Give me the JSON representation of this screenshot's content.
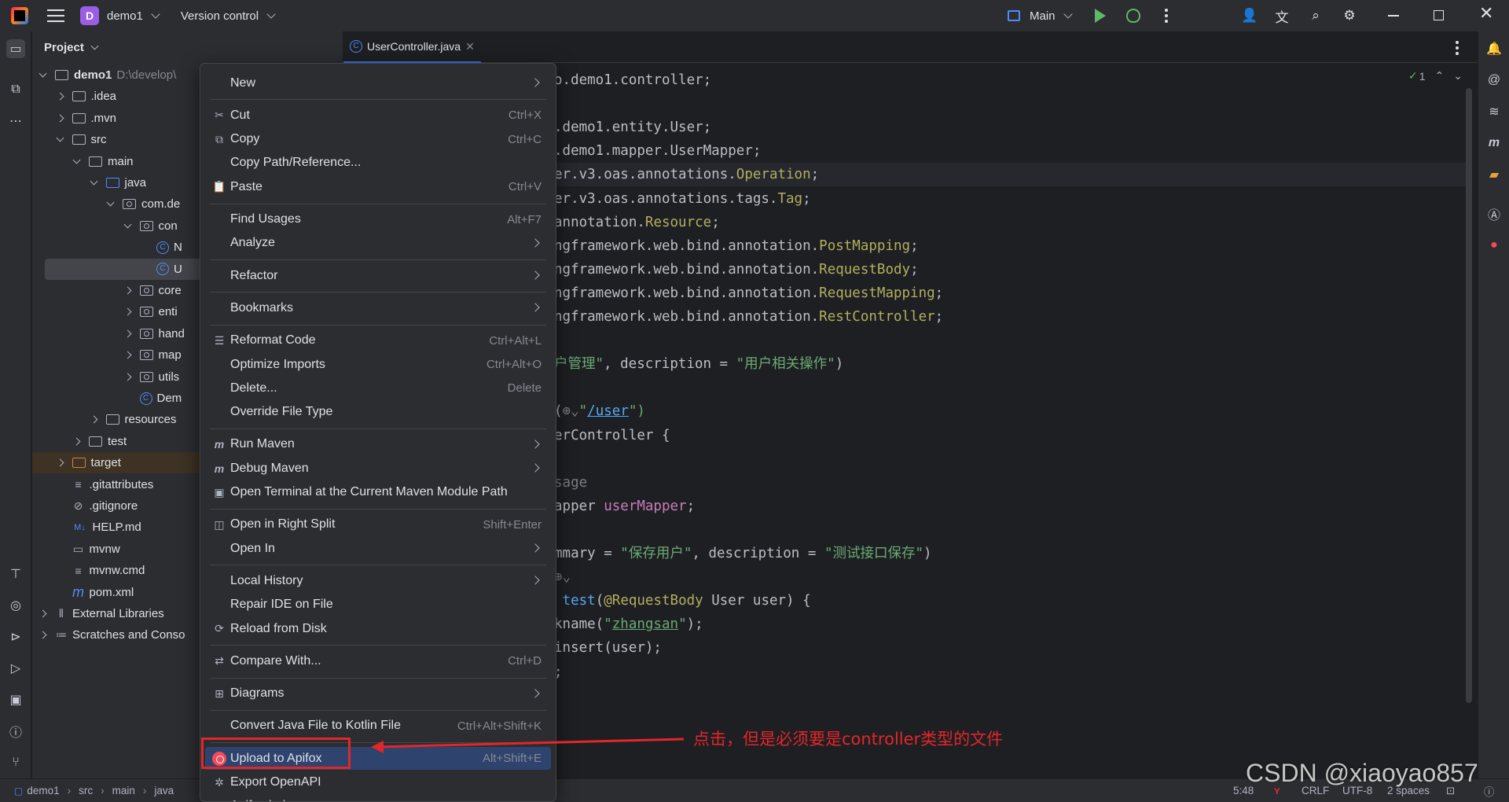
{
  "titlebar": {
    "project_letter": "D",
    "project_name": "demo1",
    "vcs": "Version control",
    "run_config": "Main"
  },
  "project_panel": {
    "title": "Project",
    "tree": [
      {
        "label": "demo1",
        "sub": "D:\\develop\\",
        "bold": true,
        "indent": 0,
        "arrow": "down",
        "icon": "module-folder"
      },
      {
        "label": ".idea",
        "indent": 1,
        "arrow": "right",
        "icon": "folder"
      },
      {
        "label": ".mvn",
        "indent": 1,
        "arrow": "right",
        "icon": "folder"
      },
      {
        "label": "src",
        "indent": 1,
        "arrow": "down",
        "icon": "folder"
      },
      {
        "label": "main",
        "indent": 2,
        "arrow": "down",
        "icon": "folder"
      },
      {
        "label": "java",
        "indent": 3,
        "arrow": "down",
        "icon": "source-folder"
      },
      {
        "label": "com.de",
        "indent": 4,
        "arrow": "down",
        "icon": "package"
      },
      {
        "label": "con",
        "indent": 5,
        "arrow": "down",
        "icon": "package"
      },
      {
        "label": "N",
        "indent": 6,
        "arrow": "none",
        "icon": "class"
      },
      {
        "label": "U",
        "indent": 6,
        "arrow": "none",
        "icon": "class",
        "selected": true
      },
      {
        "label": "core",
        "indent": 5,
        "arrow": "right",
        "icon": "package"
      },
      {
        "label": "enti",
        "indent": 5,
        "arrow": "right",
        "icon": "package"
      },
      {
        "label": "hand",
        "indent": 5,
        "arrow": "right",
        "icon": "package"
      },
      {
        "label": "map",
        "indent": 5,
        "arrow": "right",
        "icon": "package"
      },
      {
        "label": "utils",
        "indent": 5,
        "arrow": "right",
        "icon": "package"
      },
      {
        "label": "Dem",
        "indent": 5,
        "arrow": "none",
        "icon": "class"
      },
      {
        "label": "resources",
        "indent": 3,
        "arrow": "right",
        "icon": "resources-folder"
      },
      {
        "label": "test",
        "indent": 2,
        "arrow": "right",
        "icon": "folder"
      },
      {
        "label": "target",
        "indent": 1,
        "arrow": "right",
        "icon": "excluded-folder",
        "target": true
      },
      {
        "label": ".gitattributes",
        "indent": 1,
        "arrow": "none",
        "icon": "text-file"
      },
      {
        "label": ".gitignore",
        "indent": 1,
        "arrow": "none",
        "icon": "ignore-file"
      },
      {
        "label": "HELP.md",
        "indent": 1,
        "arrow": "none",
        "icon": "markdown-file"
      },
      {
        "label": "mvnw",
        "indent": 1,
        "arrow": "none",
        "icon": "shell-file"
      },
      {
        "label": "mvnw.cmd",
        "indent": 1,
        "arrow": "none",
        "icon": "text-file"
      },
      {
        "label": "pom.xml",
        "indent": 1,
        "arrow": "none",
        "icon": "maven-file"
      },
      {
        "label": "External Libraries",
        "indent": 0,
        "arrow": "right",
        "icon": "library"
      },
      {
        "label": "Scratches and Conso",
        "indent": 0,
        "arrow": "right",
        "icon": "scratches"
      }
    ]
  },
  "editor": {
    "tab_label": "UserController.java",
    "inspection_count": "1",
    "code": [
      [
        {
          "t": "o.demo1.controller;",
          "c": ""
        }
      ],
      [
        {
          "t": "",
          "c": ""
        }
      ],
      [
        {
          "t": ".demo1.entity.User;",
          "c": ""
        }
      ],
      [
        {
          "t": ".demo1.mapper.UserMapper;",
          "c": ""
        }
      ],
      [
        {
          "t": "er.v3.oas.annotations.",
          "c": ""
        },
        {
          "t": "Operation",
          "c": "a"
        },
        {
          "t": ";",
          "c": ""
        }
      ],
      [
        {
          "t": "er.v3.oas.annotations.tags.",
          "c": ""
        },
        {
          "t": "Tag",
          "c": "a"
        },
        {
          "t": ";",
          "c": ""
        }
      ],
      [
        {
          "t": "annotation.",
          "c": ""
        },
        {
          "t": "Resource",
          "c": "a"
        },
        {
          "t": ";",
          "c": ""
        }
      ],
      [
        {
          "t": "ngframework.web.bind.annotation.",
          "c": ""
        },
        {
          "t": "PostMapping",
          "c": "a"
        },
        {
          "t": ";",
          "c": ""
        }
      ],
      [
        {
          "t": "ngframework.web.bind.annotation.",
          "c": ""
        },
        {
          "t": "RequestBody",
          "c": "a"
        },
        {
          "t": ";",
          "c": ""
        }
      ],
      [
        {
          "t": "ngframework.web.bind.annotation.",
          "c": ""
        },
        {
          "t": "RequestMapping",
          "c": "a"
        },
        {
          "t": ";",
          "c": ""
        }
      ],
      [
        {
          "t": "ngframework.web.bind.annotation.",
          "c": ""
        },
        {
          "t": "RestController",
          "c": "a"
        },
        {
          "t": ";",
          "c": ""
        }
      ],
      [
        {
          "t": "",
          "c": ""
        }
      ],
      [
        {
          "t": "户管理\"",
          "c": "s"
        },
        {
          "t": ", description = ",
          "c": ""
        },
        {
          "t": "\"用户相关操作\"",
          "c": "s"
        },
        {
          "t": ")",
          "c": ""
        }
      ],
      [
        {
          "t": "",
          "c": ""
        }
      ],
      [
        {
          "t": "(",
          "c": ""
        },
        {
          "t": "⊕⌄",
          "c": "cm"
        },
        {
          "t": "\"",
          "c": "s"
        },
        {
          "t": "/user",
          "c": "u2"
        },
        {
          "t": "\")",
          "c": "s"
        }
      ],
      [
        {
          "t": "erController {",
          "c": ""
        }
      ],
      [
        {
          "t": "",
          "c": ""
        }
      ],
      [
        {
          "t": "sage",
          "c": "cm"
        }
      ],
      [
        {
          "t": "apper ",
          "c": ""
        },
        {
          "t": "userMapper",
          "c": "f"
        },
        {
          "t": ";",
          "c": ""
        }
      ],
      [
        {
          "t": "",
          "c": ""
        }
      ],
      [
        {
          "t": "mmary = ",
          "c": ""
        },
        {
          "t": "\"保存用户\"",
          "c": "s"
        },
        {
          "t": ", description = ",
          "c": ""
        },
        {
          "t": "\"测试接口保存\"",
          "c": "s"
        },
        {
          "t": ")",
          "c": ""
        }
      ],
      [
        {
          "t": "⊕⌄",
          "c": "cm"
        }
      ],
      [
        {
          "t": " ",
          "c": ""
        },
        {
          "t": "test",
          "c": "fn"
        },
        {
          "t": "(",
          "c": ""
        },
        {
          "t": "@RequestBody",
          "c": "a"
        },
        {
          "t": " User user) {",
          "c": ""
        }
      ],
      [
        {
          "t": "kname(",
          "c": ""
        },
        {
          "t": "\"",
          "c": "s"
        },
        {
          "t": "zhangsan",
          "c": "u"
        },
        {
          "t": "\"",
          "c": "s"
        },
        {
          "t": ");",
          "c": ""
        }
      ],
      [
        {
          "t": "insert(user);",
          "c": ""
        }
      ],
      [
        {
          "t": ";",
          "c": ""
        }
      ]
    ]
  },
  "context_menu": {
    "items": [
      {
        "type": "item",
        "label": "New",
        "submenu": true
      },
      {
        "type": "sep"
      },
      {
        "type": "item",
        "label": "Cut",
        "shortcut": "Ctrl+X",
        "icon": "scissors-icon",
        "glyph": "✂"
      },
      {
        "type": "item",
        "label": "Copy",
        "shortcut": "Ctrl+C",
        "icon": "copy-icon",
        "glyph": "⧉"
      },
      {
        "type": "item",
        "label": "Copy Path/Reference..."
      },
      {
        "type": "item",
        "label": "Paste",
        "shortcut": "Ctrl+V",
        "icon": "paste-icon",
        "glyph": "📋"
      },
      {
        "type": "sep"
      },
      {
        "type": "item",
        "label": "Find Usages",
        "shortcut": "Alt+F7"
      },
      {
        "type": "item",
        "label": "Analyze",
        "submenu": true
      },
      {
        "type": "sep"
      },
      {
        "type": "item",
        "label": "Refactor",
        "submenu": true
      },
      {
        "type": "sep"
      },
      {
        "type": "item",
        "label": "Bookmarks",
        "submenu": true
      },
      {
        "type": "sep"
      },
      {
        "type": "item",
        "label": "Reformat Code",
        "shortcut": "Ctrl+Alt+L",
        "icon": "reformat-icon",
        "glyph": "☰"
      },
      {
        "type": "item",
        "label": "Optimize Imports",
        "shortcut": "Ctrl+Alt+O"
      },
      {
        "type": "item",
        "label": "Delete...",
        "shortcut": "Delete"
      },
      {
        "type": "item",
        "label": "Override File Type"
      },
      {
        "type": "sep"
      },
      {
        "type": "item",
        "label": "Run Maven",
        "submenu": true,
        "icon": "maven-run-icon",
        "glyph": "m"
      },
      {
        "type": "item",
        "label": "Debug Maven",
        "submenu": true,
        "icon": "maven-debug-icon",
        "glyph": "m"
      },
      {
        "type": "item",
        "label": "Open Terminal at the Current Maven Module Path",
        "icon": "terminal-icon",
        "glyph": "▣"
      },
      {
        "type": "sep"
      },
      {
        "type": "item",
        "label": "Open in Right Split",
        "shortcut": "Shift+Enter",
        "icon": "split-icon",
        "glyph": "◫"
      },
      {
        "type": "item",
        "label": "Open In",
        "submenu": true
      },
      {
        "type": "sep"
      },
      {
        "type": "item",
        "label": "Local History",
        "submenu": true
      },
      {
        "type": "item",
        "label": "Repair IDE on File"
      },
      {
        "type": "item",
        "label": "Reload from Disk",
        "icon": "reload-icon",
        "glyph": "⟳"
      },
      {
        "type": "sep"
      },
      {
        "type": "item",
        "label": "Compare With...",
        "shortcut": "Ctrl+D",
        "icon": "compare-icon",
        "glyph": "⇄"
      },
      {
        "type": "sep"
      },
      {
        "type": "item",
        "label": "Diagrams",
        "submenu": true,
        "icon": "diagram-icon",
        "glyph": "⊞"
      },
      {
        "type": "sep"
      },
      {
        "type": "item",
        "label": "Convert Java File to Kotlin File",
        "shortcut": "Ctrl+Alt+Shift+K"
      },
      {
        "type": "sep"
      },
      {
        "type": "item",
        "label": "Upload to Apifox",
        "shortcut": "Alt+Shift+E",
        "icon": "apifox-icon",
        "highlight": true
      },
      {
        "type": "item",
        "label": "Export OpenAPI",
        "icon": "export-openapi-icon",
        "glyph": "✲"
      },
      {
        "type": "item",
        "label": "Apifox helper",
        "submenu": true
      }
    ]
  },
  "statusbar": {
    "breadcrumbs": [
      "demo1",
      "src",
      "main",
      "java"
    ],
    "position": "5:48",
    "line_sep": "CRLF",
    "encoding": "UTF-8",
    "indent": "2 spaces"
  },
  "annotation": {
    "text": "点击，但是必须要是controller类型的文件",
    "color": "#e3262a"
  },
  "watermark": "CSDN @xiaoyao857"
}
